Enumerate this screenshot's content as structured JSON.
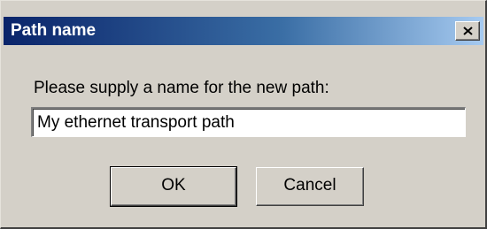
{
  "dialog": {
    "title": "Path name",
    "close_icon": "close-icon",
    "prompt": "Please supply a name for the new path:",
    "name_value": "My ethernet transport path",
    "ok_label": "OK",
    "cancel_label": "Cancel"
  },
  "colors": {
    "title_gradient_start": "#0a246a",
    "title_gradient_end": "#a6caf0",
    "dialog_face": "#d4d0c8"
  }
}
